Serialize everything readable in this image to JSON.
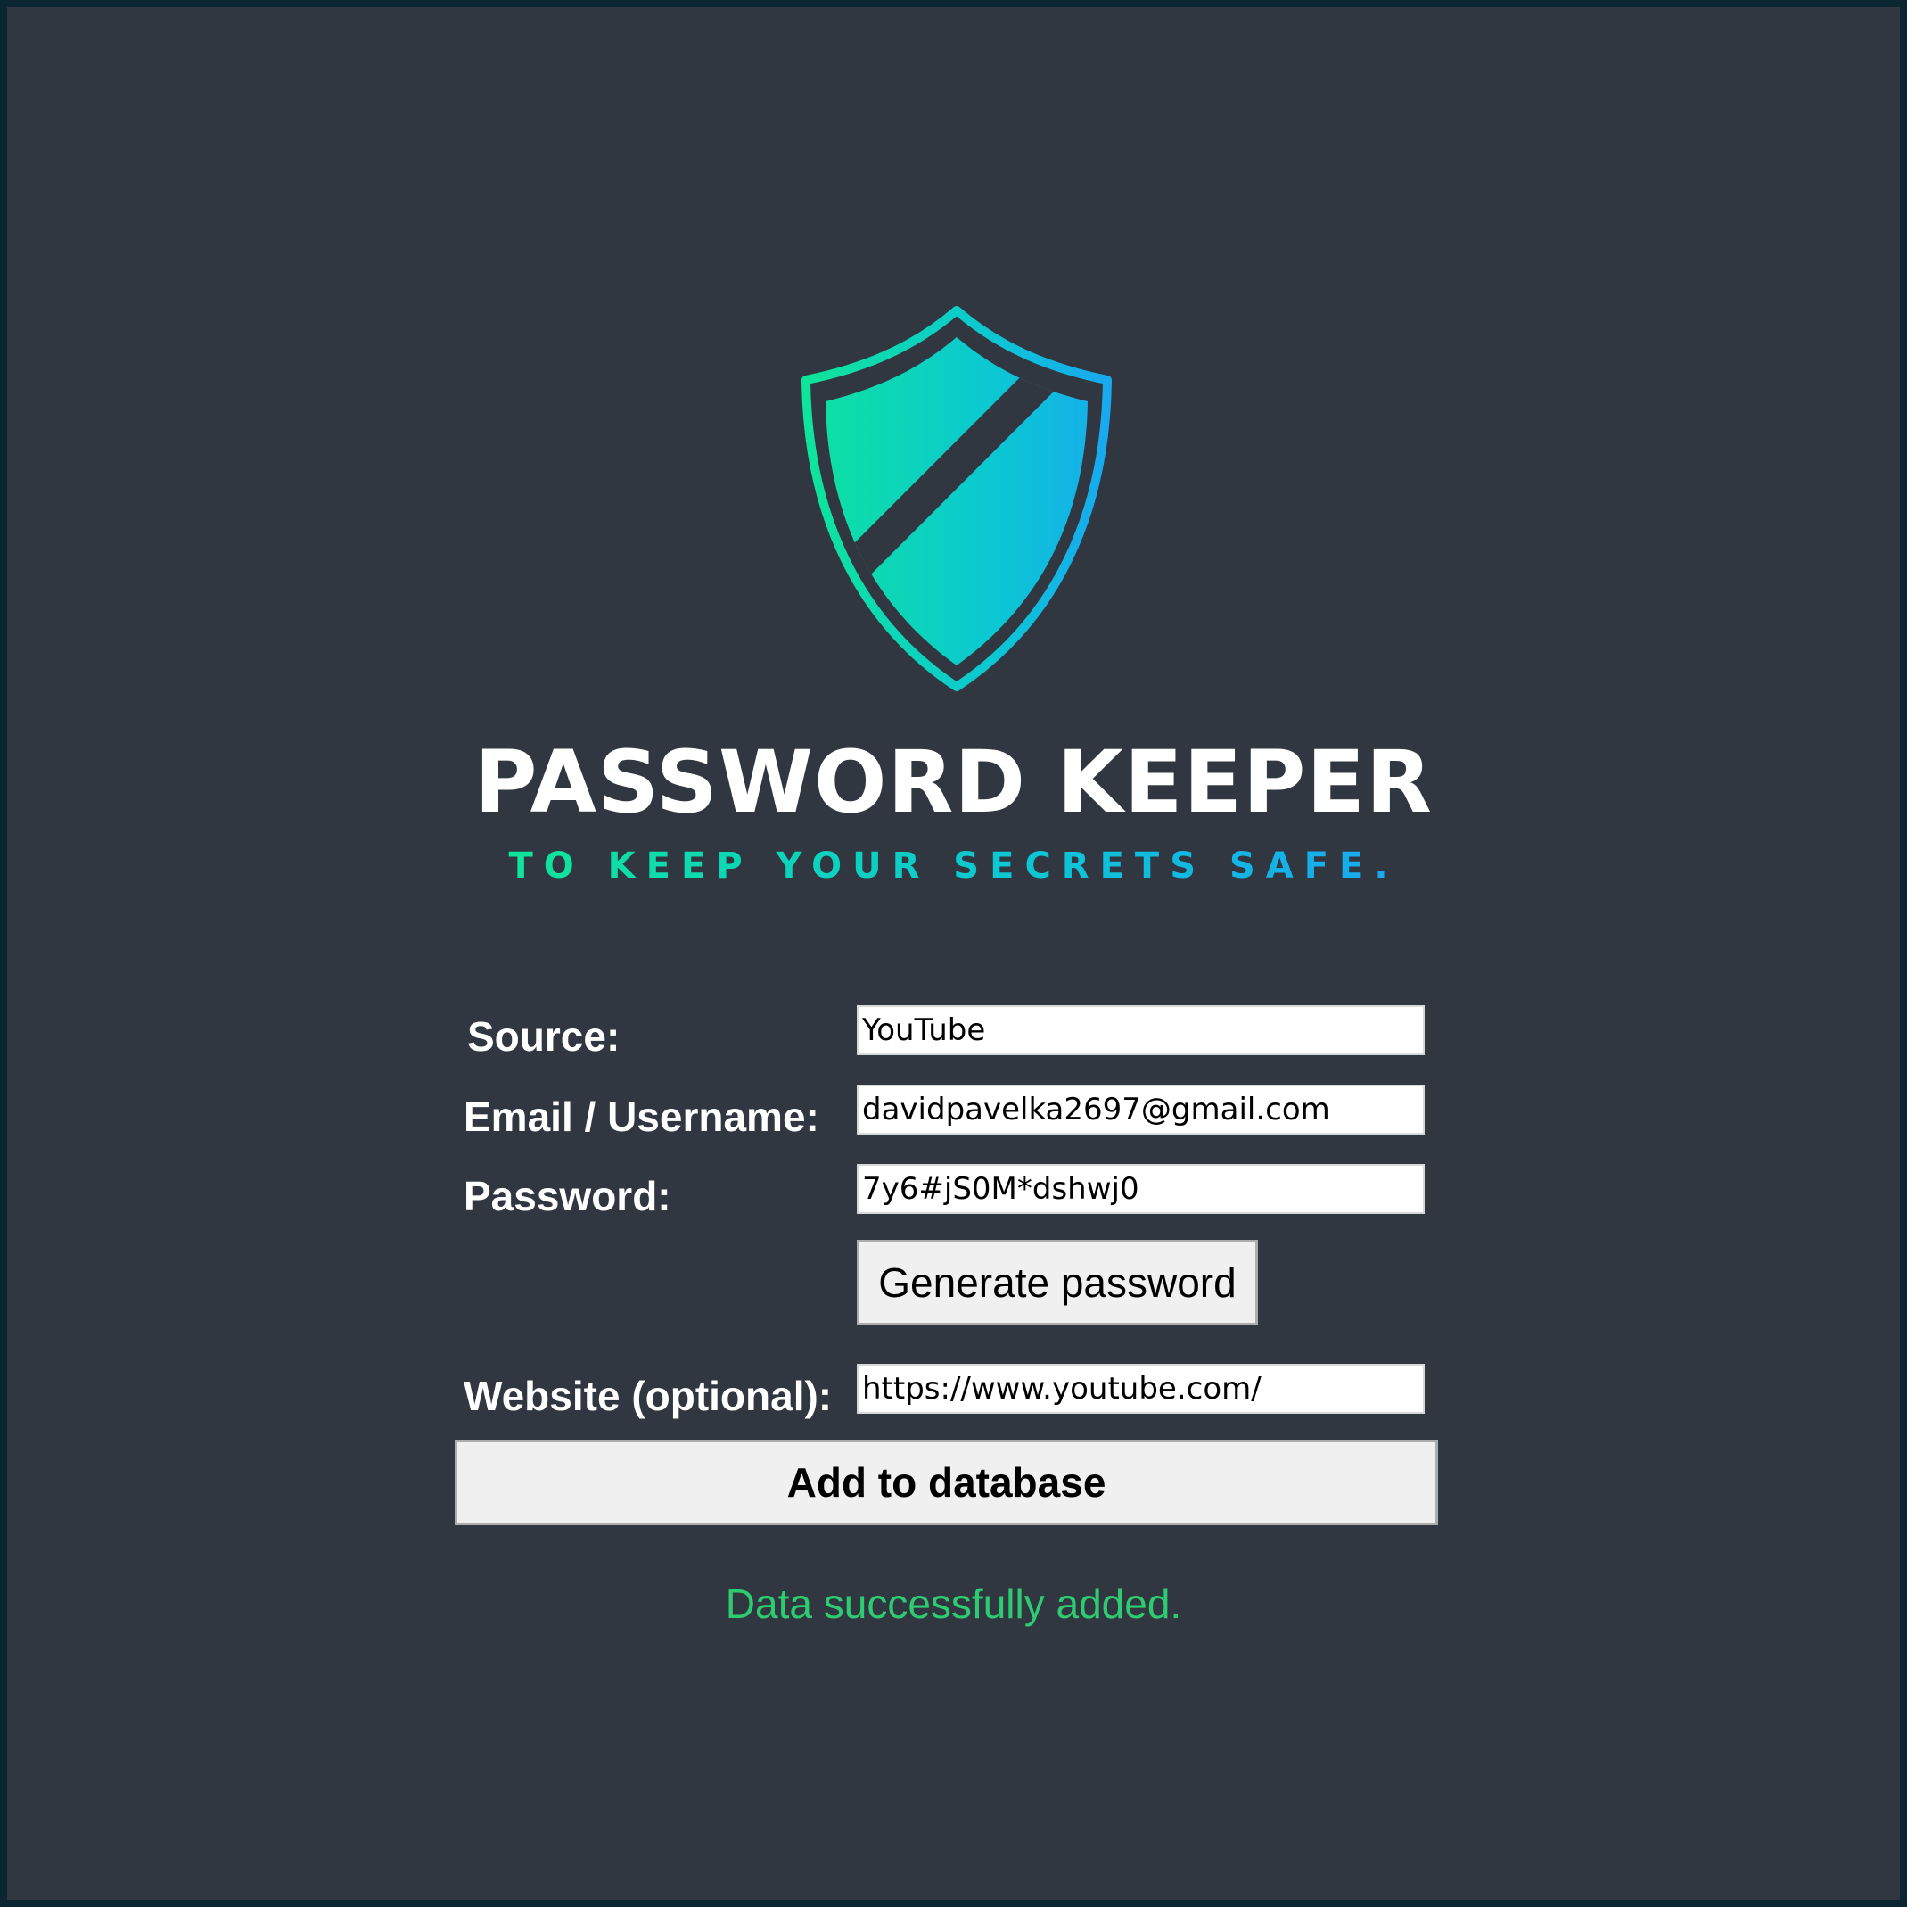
{
  "app": {
    "title": "PASSWORD KEEPER",
    "tagline": "TO KEEP YOUR SECRETS SAFE.",
    "logo_icon": "shield-icon",
    "background_color": "#313741",
    "accent_gradient": [
      "#0ee59a",
      "#18a9f0"
    ]
  },
  "form": {
    "source": {
      "label": "Source:",
      "value": "YouTube"
    },
    "email": {
      "label": "Email / Username:",
      "value": "davidpavelka2697@gmail.com"
    },
    "password": {
      "label": "Password:",
      "value": "7y6#jS0M*dshwj0"
    },
    "generate_button_label": "Generate password",
    "website": {
      "label": "Website (optional):",
      "value": "https://www.youtube.com/"
    },
    "add_button_label": "Add to database"
  },
  "status": {
    "message": "Data successfully added.",
    "color": "#2ecc71"
  }
}
